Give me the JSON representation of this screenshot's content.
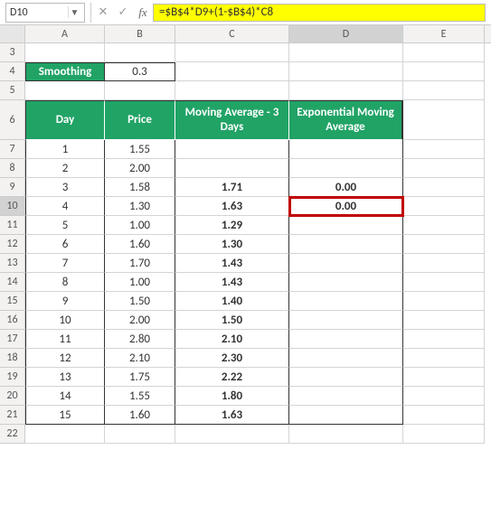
{
  "name_box": "D10",
  "formula": "=$B$4*D9+(1-$B$4)*C8",
  "columns": [
    "A",
    "B",
    "C",
    "D",
    "E"
  ],
  "selected_col": "D",
  "selected_row": "10",
  "smoothing_label": "Smoothing",
  "smoothing_value": "0.3",
  "headers": {
    "day": "Day",
    "price": "Price",
    "ma": "Moving Average - 3 Days",
    "ema": "Exponential Moving Average"
  },
  "rows": [
    {
      "n": "7",
      "day": "1",
      "price": "1.55",
      "ma": "",
      "ema": ""
    },
    {
      "n": "8",
      "day": "2",
      "price": "2.00",
      "ma": "",
      "ema": ""
    },
    {
      "n": "9",
      "day": "3",
      "price": "1.58",
      "ma": "1.71",
      "ema": "0.00"
    },
    {
      "n": "10",
      "day": "4",
      "price": "1.30",
      "ma": "1.63",
      "ema": "0.00"
    },
    {
      "n": "11",
      "day": "5",
      "price": "1.00",
      "ma": "1.29",
      "ema": ""
    },
    {
      "n": "12",
      "day": "6",
      "price": "1.60",
      "ma": "1.30",
      "ema": ""
    },
    {
      "n": "13",
      "day": "7",
      "price": "1.70",
      "ma": "1.43",
      "ema": ""
    },
    {
      "n": "14",
      "day": "8",
      "price": "1.00",
      "ma": "1.43",
      "ema": ""
    },
    {
      "n": "15",
      "day": "9",
      "price": "1.50",
      "ma": "1.40",
      "ema": ""
    },
    {
      "n": "16",
      "day": "10",
      "price": "2.00",
      "ma": "1.50",
      "ema": ""
    },
    {
      "n": "17",
      "day": "11",
      "price": "2.80",
      "ma": "2.10",
      "ema": ""
    },
    {
      "n": "18",
      "day": "12",
      "price": "2.10",
      "ma": "2.30",
      "ema": ""
    },
    {
      "n": "19",
      "day": "13",
      "price": "1.75",
      "ma": "2.22",
      "ema": ""
    },
    {
      "n": "20",
      "day": "14",
      "price": "1.55",
      "ma": "1.80",
      "ema": ""
    },
    {
      "n": "21",
      "day": "15",
      "price": "1.60",
      "ma": "1.63",
      "ema": ""
    }
  ],
  "chart_data": {
    "type": "table",
    "title": "Exponential Moving Average",
    "smoothing": 0.3,
    "columns": [
      "Day",
      "Price",
      "Moving Average - 3 Days",
      "Exponential Moving Average"
    ],
    "data": [
      [
        1,
        1.55,
        null,
        null
      ],
      [
        2,
        2.0,
        null,
        null
      ],
      [
        3,
        1.58,
        1.71,
        0.0
      ],
      [
        4,
        1.3,
        1.63,
        0.0
      ],
      [
        5,
        1.0,
        1.29,
        null
      ],
      [
        6,
        1.6,
        1.3,
        null
      ],
      [
        7,
        1.7,
        1.43,
        null
      ],
      [
        8,
        1.0,
        1.43,
        null
      ],
      [
        9,
        1.5,
        1.4,
        null
      ],
      [
        10,
        2.0,
        1.5,
        null
      ],
      [
        11,
        2.8,
        2.1,
        null
      ],
      [
        12,
        2.1,
        2.3,
        null
      ],
      [
        13,
        1.75,
        2.22,
        null
      ],
      [
        14,
        1.55,
        1.8,
        null
      ],
      [
        15,
        1.6,
        1.63,
        null
      ]
    ]
  }
}
